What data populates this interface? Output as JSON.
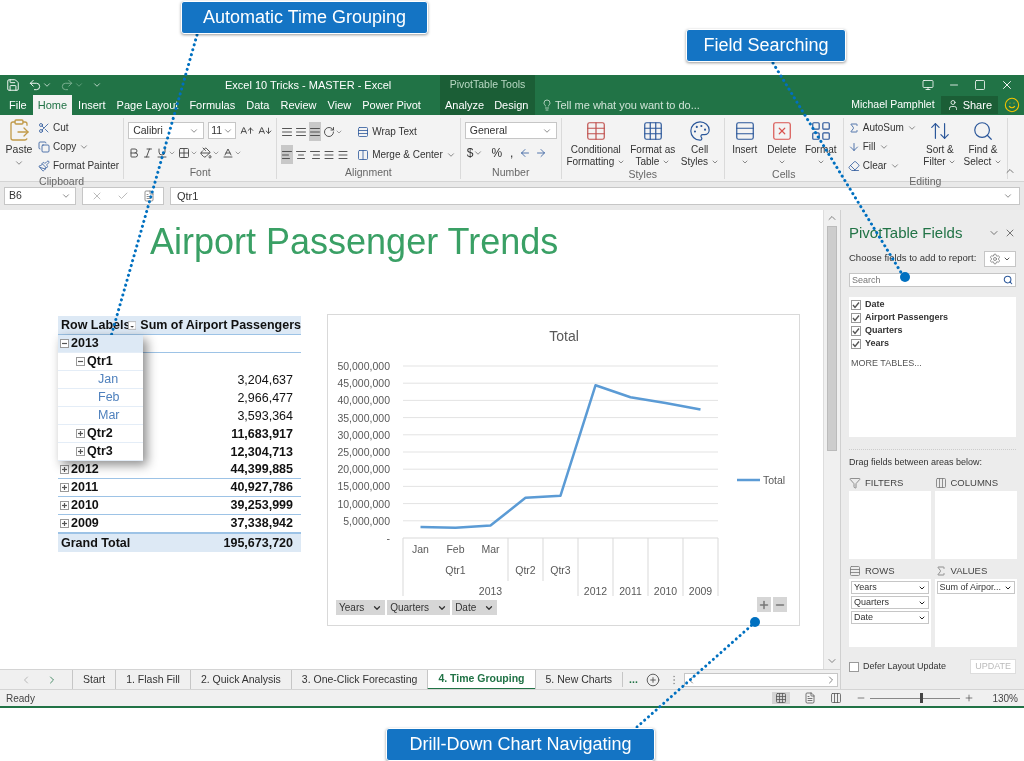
{
  "callouts": [
    {
      "text": "Automatic Time Grouping"
    },
    {
      "text": "Field Searching"
    },
    {
      "text": "Drill-Down Chart Navigating"
    }
  ],
  "title_bar": {
    "title": "Excel 10 Tricks - MASTER - Excel",
    "context": "PivotTable Tools"
  },
  "tabs": [
    {
      "label": "File",
      "selected": false,
      "contextual": false
    },
    {
      "label": "Home",
      "selected": true,
      "contextual": false
    },
    {
      "label": "Insert",
      "selected": false,
      "contextual": false
    },
    {
      "label": "Page Layout",
      "selected": false,
      "contextual": false
    },
    {
      "label": "Formulas",
      "selected": false,
      "contextual": false
    },
    {
      "label": "Data",
      "selected": false,
      "contextual": false
    },
    {
      "label": "Review",
      "selected": false,
      "contextual": false
    },
    {
      "label": "View",
      "selected": false,
      "contextual": false
    },
    {
      "label": "Power Pivot",
      "selected": false,
      "contextual": false
    },
    {
      "label": "Analyze",
      "selected": false,
      "contextual": true
    },
    {
      "label": "Design",
      "selected": false,
      "contextual": true
    }
  ],
  "tell_me": {
    "placeholder": "Tell me what you want to do..."
  },
  "user": "Michael Pamphlet",
  "share": "Share",
  "ribbon": {
    "groups": [
      {
        "kind": "clipboard",
        "label": "Clipboard",
        "buttons": [
          "Paste",
          "Cut",
          "Copy",
          "Format Painter"
        ]
      },
      {
        "kind": "font",
        "label": "Font",
        "font": "Calibri",
        "size": "11"
      },
      {
        "kind": "alignment",
        "label": "Alignment",
        "buttons": [
          "Wrap Text",
          "Merge & Center"
        ]
      },
      {
        "kind": "number",
        "label": "Number",
        "format": "General",
        "symbols": [
          "$",
          "%",
          ","
        ]
      },
      {
        "kind": "styles",
        "label": "Styles",
        "buttons": [
          "Conditional Formatting",
          "Format as Table",
          "Cell Styles"
        ]
      },
      {
        "kind": "cells",
        "label": "Cells",
        "buttons": [
          "Insert",
          "Delete",
          "Format"
        ]
      },
      {
        "kind": "editing",
        "label": "Editing",
        "buttons": [
          "AutoSum",
          "Fill",
          "Clear",
          "Sort & Filter",
          "Find & Select"
        ]
      }
    ]
  },
  "formula_bar": {
    "name_box": "B6",
    "formula": "Qtr1"
  },
  "sheet": {
    "title": "Airport Passenger Trends",
    "pivot": {
      "columns": [
        "Row Labels",
        "Sum of Airport Passengers"
      ],
      "rows": [
        {
          "kind": "year",
          "label": "2013",
          "expanded": true,
          "lifted": true,
          "children": [
            {
              "kind": "quarter",
              "label": "Qtr1",
              "expanded": true,
              "children": [
                {
                  "kind": "month",
                  "label": "Jan",
                  "value": "3,204,637"
                },
                {
                  "kind": "month",
                  "label": "Feb",
                  "value": "2,966,477"
                },
                {
                  "kind": "month",
                  "label": "Mar",
                  "value": "3,593,364"
                }
              ]
            },
            {
              "kind": "quarter",
              "label": "Qtr2",
              "expanded": false,
              "value": "11,683,917"
            },
            {
              "kind": "quarter",
              "label": "Qtr3",
              "expanded": false,
              "value": "12,304,713"
            }
          ]
        },
        {
          "kind": "year",
          "label": "2012",
          "expanded": false,
          "lifted": false,
          "value": "44,399,885"
        },
        {
          "kind": "year",
          "label": "2011",
          "expanded": false,
          "lifted": false,
          "value": "40,927,786"
        },
        {
          "kind": "year",
          "label": "2010",
          "expanded": false,
          "lifted": false,
          "value": "39,253,999"
        },
        {
          "kind": "year",
          "label": "2009",
          "expanded": false,
          "lifted": false,
          "value": "37,338,942"
        }
      ],
      "total": {
        "label": "Grand Total",
        "value": "195,673,720"
      }
    },
    "chart": {
      "axis_rows": [
        [
          "Jan",
          "Feb",
          "Mar"
        ],
        [
          "Qtr1",
          "Qtr2",
          "Qtr3"
        ],
        [
          "2013",
          "2012",
          "2011",
          "2010",
          "2009"
        ]
      ],
      "filters": [
        "Years",
        "Quarters",
        "Date"
      ],
      "chart_data": {
        "type": "line",
        "title": "Total",
        "series": [
          {
            "name": "Total",
            "color": "#5b9bd5",
            "values": [
              3204637,
              2966477,
              3593364,
              11683917,
              12304713,
              44399885,
              40927786,
              39253999,
              37338942
            ]
          }
        ],
        "ylim": [
          0,
          50000000
        ],
        "grid": true,
        "yticks": [
          {
            "value": 0,
            "label": "-"
          },
          {
            "value": 5000000,
            "label": "5,000,000"
          },
          {
            "value": 10000000,
            "label": "10,000,000"
          },
          {
            "value": 15000000,
            "label": "15,000,000"
          },
          {
            "value": 20000000,
            "label": "20,000,000"
          },
          {
            "value": 25000000,
            "label": "25,000,000"
          },
          {
            "value": 30000000,
            "label": "30,000,000"
          },
          {
            "value": 35000000,
            "label": "35,000,000"
          },
          {
            "value": 40000000,
            "label": "40,000,000"
          },
          {
            "value": 45000000,
            "label": "45,000,000"
          },
          {
            "value": 50000000,
            "label": "50,000,000"
          }
        ]
      }
    }
  },
  "sheet_tabs": [
    {
      "label": "Start",
      "selected": false
    },
    {
      "label": "1. Flash Fill",
      "selected": false
    },
    {
      "label": "2. Quick Analysis",
      "selected": false
    },
    {
      "label": "3. One-Click Forecasting",
      "selected": false
    },
    {
      "label": "4. Time Grouping",
      "selected": true
    },
    {
      "label": "5. New Charts",
      "selected": false
    }
  ],
  "more_tabs": "...",
  "pane": {
    "title": "PivotTable Fields",
    "subtitle": "Choose fields to add to report:",
    "search": {
      "placeholder": "Search"
    },
    "fields": [
      {
        "label": "Date",
        "checked": true
      },
      {
        "label": "Airport Passengers",
        "checked": true
      },
      {
        "label": "Quarters",
        "checked": true
      },
      {
        "label": "Years",
        "checked": true
      }
    ],
    "more": "MORE TABLES...",
    "drag_hint": "Drag fields between areas below:",
    "areas": [
      {
        "kind": "filters",
        "label": "FILTERS"
      },
      {
        "kind": "columns",
        "label": "COLUMNS"
      },
      {
        "kind": "rows",
        "label": "ROWS",
        "items": [
          "Years",
          "Quarters",
          "Date"
        ]
      },
      {
        "kind": "values",
        "label": "VALUES",
        "items": [
          "Sum of Airpor..."
        ]
      }
    ],
    "defer": {
      "label": "Defer Layout Update",
      "checked": false
    },
    "update": {
      "label": "UPDATE",
      "disabled": true
    }
  },
  "status_bar": {
    "text": "Ready",
    "zoom": {
      "level": 0.55,
      "reading": "130%"
    }
  }
}
